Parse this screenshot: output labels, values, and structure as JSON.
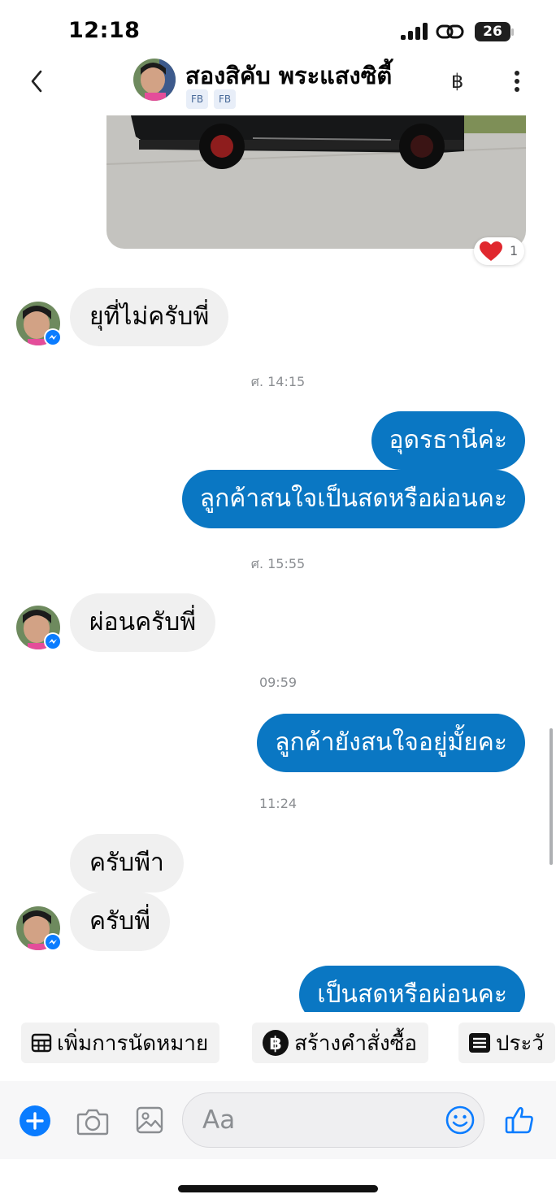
{
  "status_bar": {
    "time": "12:18",
    "battery": "26",
    "icons": [
      "signal-icon",
      "link-icon",
      "battery-icon"
    ]
  },
  "header": {
    "title": "สองสิคับ พระแสงซิตี้",
    "tags": [
      "FB",
      "FB"
    ],
    "icons": [
      "back-chevron-icon",
      "baht-icon",
      "more-vertical-icon"
    ]
  },
  "messages": {
    "photo_reaction": {
      "emoji": "heart-icon",
      "count": "1"
    },
    "in_1": "ยุที่ไม่ครับพี่",
    "ts_1": "ศ. 14:15",
    "out_1a": "อุดรธานีค่ะ",
    "out_1b": "ลูกค้าสนใจเป็นสดหรือผ่อนคะ",
    "ts_2": "ศ. 15:55",
    "in_2": "ผ่อนครับพี่",
    "ts_3": "09:59",
    "out_2": "ลูกค้ายังสนใจอยู่มั้ยคะ",
    "ts_4": "11:24",
    "in_3a": "ครับพีา",
    "in_3b": "ครับพี่",
    "out_3": "เป็นสดหรือผ่อนคะ"
  },
  "quick_actions": [
    {
      "label": "เพิ่มการนัดหมาย",
      "icon": "calendar-icon"
    },
    {
      "label": "สร้างคำสั่งซื้อ",
      "icon": "baht-circle-icon"
    },
    {
      "label": "ประวั",
      "icon": "list-icon"
    }
  ],
  "composer": {
    "placeholder": "Aa",
    "icons": [
      "plus-icon",
      "camera-icon",
      "image-icon",
      "emoji-icon",
      "thumbs-up-icon"
    ]
  },
  "colors": {
    "accent": "#0a77c3",
    "incoming_bubble": "#f0f0f0",
    "messenger_blue": "#0a7cff"
  }
}
